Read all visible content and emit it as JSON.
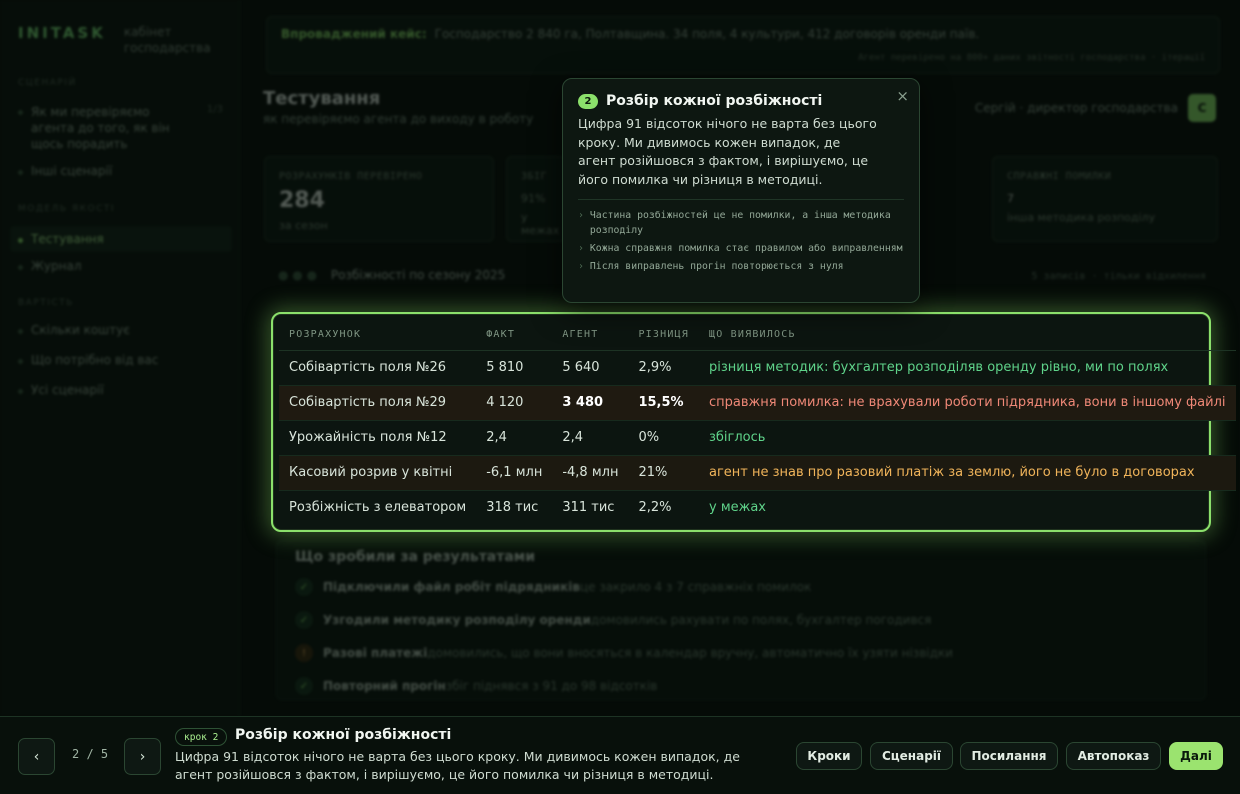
{
  "sidebar": {
    "logo": "INITASK",
    "subtitle": "кабінет господарства",
    "section_scenario": "СЦЕНАРІЙ",
    "scenario_item": "Як ми перевіряємо агента до того, як він щось порадить",
    "scenario_meta": "1/3",
    "other_scenarios": "Інші сценарії",
    "section_model": "МОДЕЛЬ ЯКОСТІ",
    "nav_testing": "Тестування",
    "nav_journal": "Журнал",
    "section_cost": "ВАРТІСТЬ",
    "nav_cost": "Скільки коштує",
    "nav_need": "Що потрібно від вас",
    "nav_all": "Усі сценарії"
  },
  "strip": {
    "label": "Впроваджений кейс:",
    "text": "Господарство 2 840 га, Полтавщина. 34 поля, 4 культури, 412 договорів оренди паїв.",
    "meta": "Агент перевірено на 800+ даних звітності господарства · ітерації"
  },
  "header": {
    "title": "Тестування",
    "subtitle": "як перевіряємо агента до виходу в роботу",
    "user_name": "Сергій · директор господарства",
    "avatar": "С"
  },
  "cards": [
    {
      "k": "РОЗРАХУНКІВ ПЕРЕВІРЕНО",
      "v": "284",
      "n": "за сезон"
    },
    {
      "k": "ЗБІГ",
      "v": "91%",
      "n": "у межах"
    },
    {
      "k": "СПРАВЖНІ ПОМИЛКИ",
      "v": "7",
      "n": "інша методика розподілу"
    }
  ],
  "subbar": {
    "title": "Розбіжності по сезону 2025",
    "meta": "5 записів · тільки відхилення"
  },
  "table": {
    "columns": [
      "РОЗРАХУНОК",
      "ФАКТ",
      "АГЕНТ",
      "РІЗНИЦЯ",
      "ЩО ВИЯВИЛОСЬ"
    ],
    "rows": [
      {
        "name": "Собівартість поля №26",
        "fact": "5 810",
        "agent": "5 640",
        "diff": "2,9%",
        "note": "різниця методик: бухгалтер розподіляв оренду рівно, ми по полях",
        "status": "ok"
      },
      {
        "name": "Собівартість поля №29",
        "fact": "4 120",
        "agent": "3 480",
        "diff": "15,5%",
        "note": "справжня помилка: не врахували роботи підрядника, вони в іншому файлі",
        "status": "err"
      },
      {
        "name": "Урожайність поля №12",
        "fact": "2,4",
        "agent": "2,4",
        "diff": "0%",
        "note": "збіглось",
        "status": "ok"
      },
      {
        "name": "Касовий розрив у квітні",
        "fact": "-6,1 млн",
        "agent": "-4,8 млн",
        "diff": "21%",
        "note": "агент не знав про разовий платіж за землю, його не було в договорах",
        "status": "warn"
      },
      {
        "name": "Розбіжність з елеватором",
        "fact": "318 тис",
        "agent": "311 тис",
        "diff": "2,2%",
        "note": "у межах",
        "status": "ok"
      }
    ]
  },
  "results": {
    "title": "Що зробили за результатами",
    "items": [
      {
        "b": "Підключили файл робіт підрядників",
        "t": "це закрило 4 з 7 справжніх помилок",
        "icon": "check-icon"
      },
      {
        "b": "Узгодили методику розподілу оренди",
        "t": "домовились рахувати по полях, бухгалтер погодився",
        "icon": "check-icon"
      },
      {
        "b": "Разові платежі",
        "t": "домовились, що вони вносяться в календар вручну, автоматично їх узяти нізвідки",
        "icon": "warning-icon"
      },
      {
        "b": "Повторний прогін",
        "t": "збіг піднявся з 91 до 98 відсотків",
        "icon": "check-icon"
      }
    ]
  },
  "popover": {
    "step": "2",
    "title": "Розбір кожної розбіжності",
    "body": "Цифра 91 відсоток нічого не варта без цього кроку. Ми дивимось кожен випадок, де агент розійшовся з фактом, і вирішуємо, це його помилка чи різниця в методиці.",
    "points": [
      "Частина розбіжностей це не помилки, а інша методика розподілу",
      "Кожна справжня помилка стає правилом або виправленням",
      "Після виправлень прогін повторюється з нуля"
    ],
    "close": "×"
  },
  "bottom": {
    "prev": "‹",
    "next": "›",
    "pager": "2 / 5",
    "step_tag": "крок 2",
    "title": "Розбір кожної розбіжності",
    "body": "Цифра 91 відсоток нічого не варта без цього кроку. Ми дивимось кожен випадок, де агент розійшовся з фактом, і вирішуємо, це його помилка чи різниця в методиці.",
    "btn_steps": "Кроки",
    "btn_scenarios": "Сценарії",
    "btn_link": "Посилання",
    "btn_autoshow": "Автопоказ",
    "btn_next": "Далі"
  },
  "colors": {
    "accent": "#8be06b",
    "ok": "#5fd38a",
    "err": "#ef8877",
    "warn": "#f0b45a",
    "bg": "#070d09"
  }
}
